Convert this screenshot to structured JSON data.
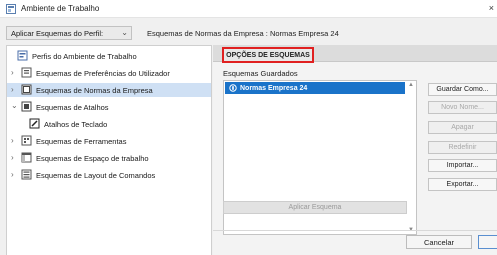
{
  "window": {
    "title": "Ambiente de Trabalho",
    "close": "×"
  },
  "profile": {
    "label": "Aplicar Esquemas do Perfil:",
    "chevron": "⌄"
  },
  "scheme_header": "Esquemas de Normas da Empresa : Normas Empresa 24",
  "tree": {
    "items": [
      {
        "label": "Perfis do Ambiente de Trabalho",
        "icon": "profile-icon"
      },
      {
        "label": "Esquemas de Preferências do Utilizador",
        "icon": "preferences-icon"
      },
      {
        "label": "Esquemas de Normas da Empresa",
        "icon": "company-standards-icon"
      },
      {
        "label": "Esquemas de Atalhos",
        "icon": "shortcuts-icon"
      },
      {
        "label": "Atalhos de Teclado",
        "icon": "keyboard-shortcuts-icon"
      },
      {
        "label": "Esquemas de Ferramentas",
        "icon": "tools-icon"
      },
      {
        "label": "Esquemas de Espaço de trabalho",
        "icon": "workspace-icon"
      },
      {
        "label": "Esquemas de Layout de Comandos",
        "icon": "command-layout-icon"
      }
    ]
  },
  "options": {
    "tab_label": "OPÇÕES DE ESQUEMAS",
    "saved_label": "Esquemas Guardados",
    "saved_items": [
      "Normas Empresa 24"
    ],
    "apply_button": "Aplicar Esquema"
  },
  "side_buttons": {
    "save": "Guardar Como...",
    "new": "Novo Nome...",
    "delete": "Apagar",
    "redefine": "Redefinir",
    "import": "Importar...",
    "export": "Exportar..."
  },
  "footer": {
    "cancel": "Cancelar"
  },
  "colors": {
    "selection": "#1a73c9",
    "highlight_border": "#e02020",
    "tree_selected": "#cfe0f4"
  }
}
